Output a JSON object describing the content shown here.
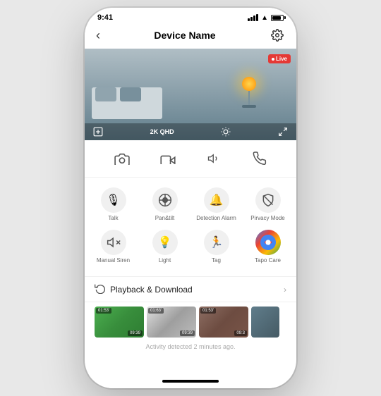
{
  "statusBar": {
    "time": "9:41",
    "signal": [
      2,
      3,
      4,
      5
    ],
    "batteryLevel": 85
  },
  "nav": {
    "back": "‹",
    "title": "Device Name",
    "settingsLabel": "settings"
  },
  "camera": {
    "liveBadge": "Live",
    "quality": "2K QHD"
  },
  "actionButtons": [
    {
      "id": "screenshot",
      "icon": "📷",
      "label": ""
    },
    {
      "id": "record",
      "icon": "🎬",
      "label": ""
    },
    {
      "id": "speaker",
      "icon": "🔊",
      "label": ""
    },
    {
      "id": "call",
      "icon": "📞",
      "label": ""
    }
  ],
  "features": [
    {
      "id": "talk",
      "icon": "🎙",
      "label": "Talk"
    },
    {
      "id": "pantilt",
      "icon": "⊕",
      "label": "Pan&tilt"
    },
    {
      "id": "detection",
      "icon": "🔔",
      "label": "Detection Alarm"
    },
    {
      "id": "privacy",
      "icon": "🚫",
      "label": "Pirvacy Mode"
    },
    {
      "id": "siren",
      "icon": "🔇",
      "label": "Manual Siren"
    },
    {
      "id": "light",
      "icon": "💡",
      "label": "Light"
    },
    {
      "id": "tag",
      "icon": "🏃",
      "label": "Tag"
    },
    {
      "id": "tapocare",
      "icon": "C",
      "label": "Tapo Care"
    }
  ],
  "playback": {
    "icon": "⟳",
    "title": "Playback & Download",
    "chevron": "›",
    "thumbnails": [
      {
        "timestamp": "01:53'",
        "duration": "09:39"
      },
      {
        "timestamp": "01:63'",
        "duration": "09:39"
      },
      {
        "timestamp": "01:53'",
        "duration": "09:3"
      }
    ],
    "activityText": "Activity detected 2 minutes ago."
  }
}
